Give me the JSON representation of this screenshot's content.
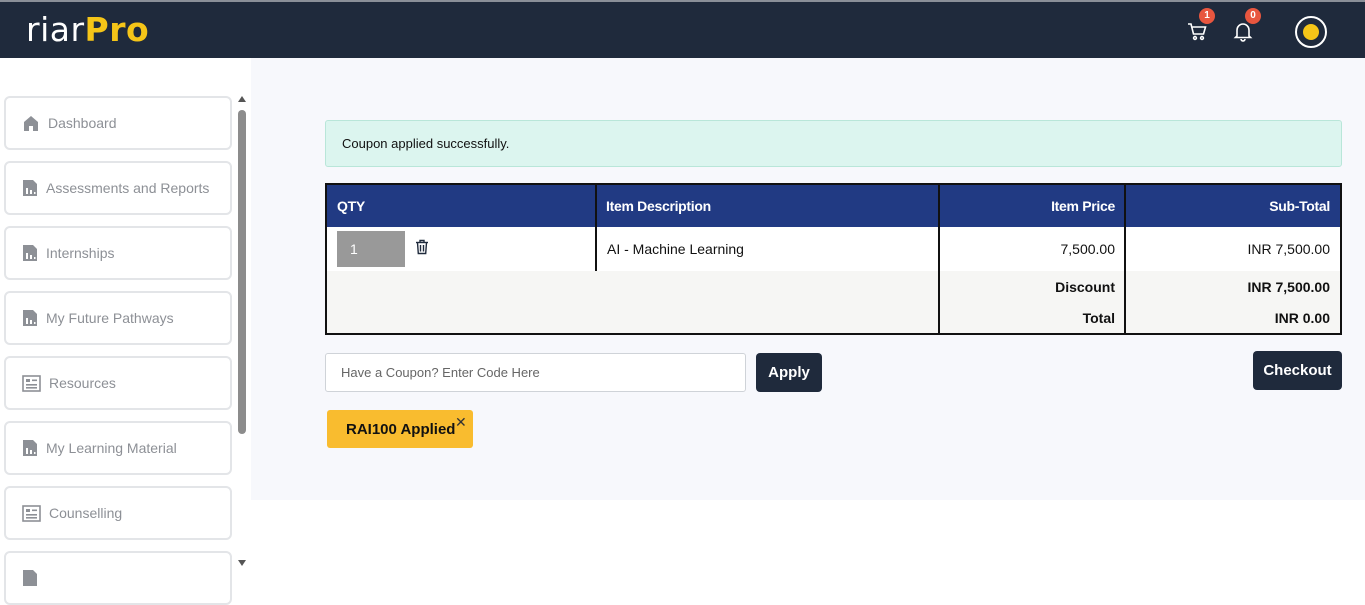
{
  "header": {
    "logo_part1": "riar",
    "logo_part2": "Pro",
    "cart_count": "1",
    "notification_count": "0",
    "icons": [
      "cart-icon",
      "bell-icon",
      "avatar"
    ]
  },
  "sidebar": {
    "items": [
      {
        "label": "Dashboard",
        "icon": "home-icon"
      },
      {
        "label": "Assessments and Reports",
        "icon": "report-icon"
      },
      {
        "label": "Internships",
        "icon": "report-icon"
      },
      {
        "label": "My Future Pathways",
        "icon": "report-icon"
      },
      {
        "label": "Resources",
        "icon": "list-icon"
      },
      {
        "label": "My Learning Material",
        "icon": "report-icon"
      },
      {
        "label": "Counselling",
        "icon": "list-icon"
      }
    ]
  },
  "alert": {
    "message": "Coupon applied successfully."
  },
  "cart": {
    "headers": {
      "qty": "QTY",
      "description": "Item Description",
      "price": "Item Price",
      "subtotal": "Sub-Total"
    },
    "items": [
      {
        "qty": "1",
        "description": "AI - Machine Learning",
        "price": "7,500.00",
        "subtotal": "INR 7,500.00"
      }
    ],
    "discount_label": "Discount",
    "discount_value": "INR 7,500.00",
    "total_label": "Total",
    "total_value": "INR 0.00"
  },
  "coupon": {
    "placeholder": "Have a Coupon? Enter Code Here",
    "apply_label": "Apply",
    "applied_label": "RAI100 Applied",
    "remove_symbol": "✕"
  },
  "checkout_label": "Checkout",
  "colors": {
    "topbar": "#1f2a3c",
    "accent_yellow": "#f5c518",
    "table_header": "#213a83",
    "alert_bg": "#dcf5ef",
    "badge": "#e8563f",
    "coupon_tag": "#f9bc2f"
  }
}
